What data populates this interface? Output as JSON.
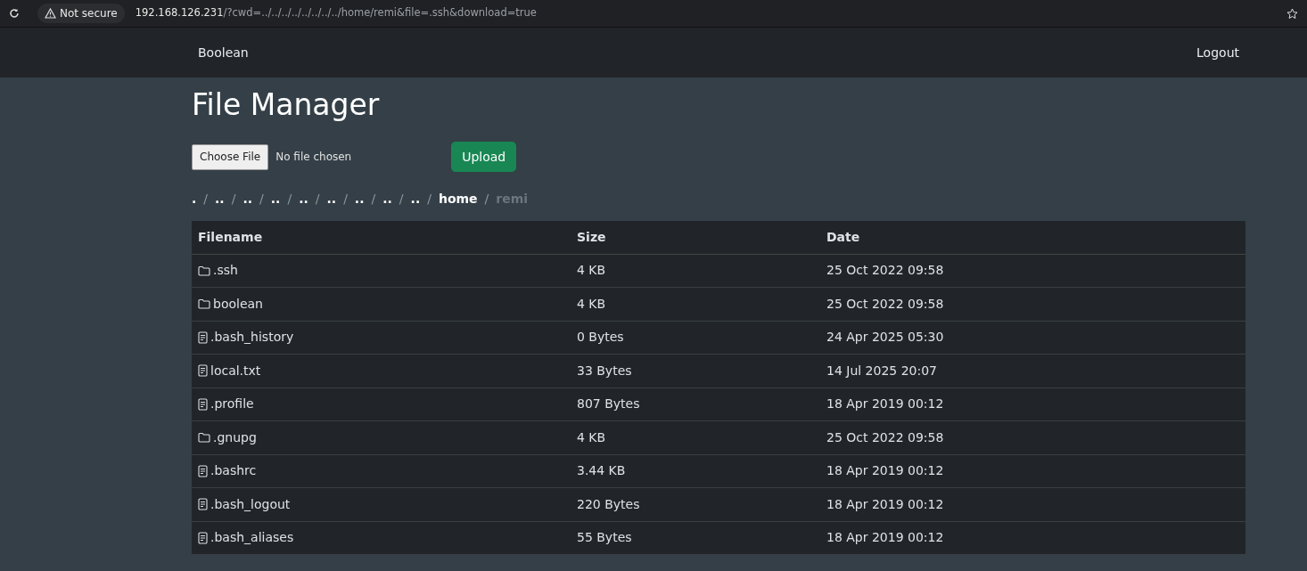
{
  "browser": {
    "security": "Not secure",
    "url_host": "192.168.126.231",
    "url_path": "/?cwd=../../../../../../../../home/remi&file=.ssh&download=true"
  },
  "navbar": {
    "brand": "Boolean",
    "logout": "Logout"
  },
  "title": "File Manager",
  "upload": {
    "choose_button": "Choose File",
    "file_status": "No file chosen",
    "upload_button": "Upload"
  },
  "breadcrumb": [
    {
      "label": ".",
      "current": false
    },
    {
      "separator": "/",
      "label": "..",
      "current": false
    },
    {
      "separator": "/",
      "label": "..",
      "current": false
    },
    {
      "separator": "/",
      "label": "..",
      "current": false
    },
    {
      "separator": "/",
      "label": "..",
      "current": false
    },
    {
      "separator": "/",
      "label": "..",
      "current": false
    },
    {
      "separator": "/",
      "label": "..",
      "current": false
    },
    {
      "separator": "/",
      "label": "..",
      "current": false
    },
    {
      "separator": "/",
      "label": "..",
      "current": false
    },
    {
      "separator": "/",
      "label": "home",
      "current": false
    },
    {
      "separator": "/",
      "label": "remi",
      "current": true
    }
  ],
  "table": {
    "columns": [
      "Filename",
      "Size",
      "Date"
    ],
    "rows": [
      {
        "kind": "folder",
        "name": ".ssh",
        "size": "4 KB",
        "date": "25 Oct 2022 09:58"
      },
      {
        "kind": "folder",
        "name": "boolean",
        "size": "4 KB",
        "date": "25 Oct 2022 09:58"
      },
      {
        "kind": "file",
        "name": ".bash_history",
        "size": "0 Bytes",
        "date": "24 Apr 2025 05:30"
      },
      {
        "kind": "file",
        "name": "local.txt",
        "size": "33 Bytes",
        "date": "14 Jul 2025 20:07"
      },
      {
        "kind": "file",
        "name": ".profile",
        "size": "807 Bytes",
        "date": "18 Apr 2019 00:12"
      },
      {
        "kind": "folder",
        "name": ".gnupg",
        "size": "4 KB",
        "date": "25 Oct 2022 09:58"
      },
      {
        "kind": "file",
        "name": ".bashrc",
        "size": "3.44 KB",
        "date": "18 Apr 2019 00:12"
      },
      {
        "kind": "file",
        "name": ".bash_logout",
        "size": "220 Bytes",
        "date": "18 Apr 2019 00:12"
      },
      {
        "kind": "file",
        "name": ".bash_aliases",
        "size": "55 Bytes",
        "date": "18 Apr 2019 00:12"
      }
    ]
  }
}
